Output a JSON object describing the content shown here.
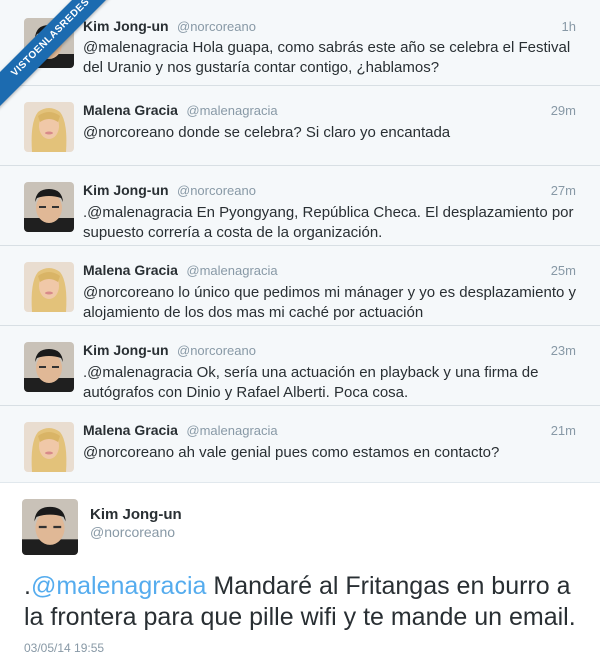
{
  "watermark": "VISTOENLASREDES",
  "users": {
    "kim": {
      "name": "Kim Jong-un",
      "handle": "@norcoreano"
    },
    "malena": {
      "name": "Malena Gracia",
      "handle": "@malenagracia"
    }
  },
  "tweets": [
    {
      "time": "1h",
      "text": "@malenagracia Hola guapa, como sabrás este año se celebra el Festival del Uranio y nos gustaría contar contigo, ¿hablamos?"
    },
    {
      "time": "29m",
      "text": "@norcoreano donde se celebra? Si claro yo encantada"
    },
    {
      "time": "27m",
      "text": ".@malenagracia En Pyongyang, República Checa. El desplazamiento por supuesto correría a costa de la organización."
    },
    {
      "time": "25m",
      "text": "@norcoreano lo único que pedimos mi mánager y yo es desplazamiento y alojamiento de los dos mas mi caché por actuación"
    },
    {
      "time": "23m",
      "text": ".@malenagracia Ok, sería una actuación en playback y una firma de autógrafos con Dinio y Rafael Alberti. Poca cosa."
    },
    {
      "time": "21m",
      "text": "@norcoreano ah vale genial pues como estamos en contacto?"
    }
  ],
  "detail": {
    "name": "Kim Jong-un",
    "handle": "@norcoreano",
    "text_prefix": ".",
    "mention": "@malenagracia",
    "text_rest": " Mandaré al Fritangas en burro a la frontera para que pille wifi y te mande un email.",
    "date": "03/05/14 19:55"
  },
  "colors": {
    "link": "#55acee",
    "muted": "#8899a6",
    "ribbon": "#1c6bb0"
  },
  "icons": {
    "kim_avatar": "man-avatar-icon",
    "malena_avatar": "woman-avatar-icon"
  }
}
